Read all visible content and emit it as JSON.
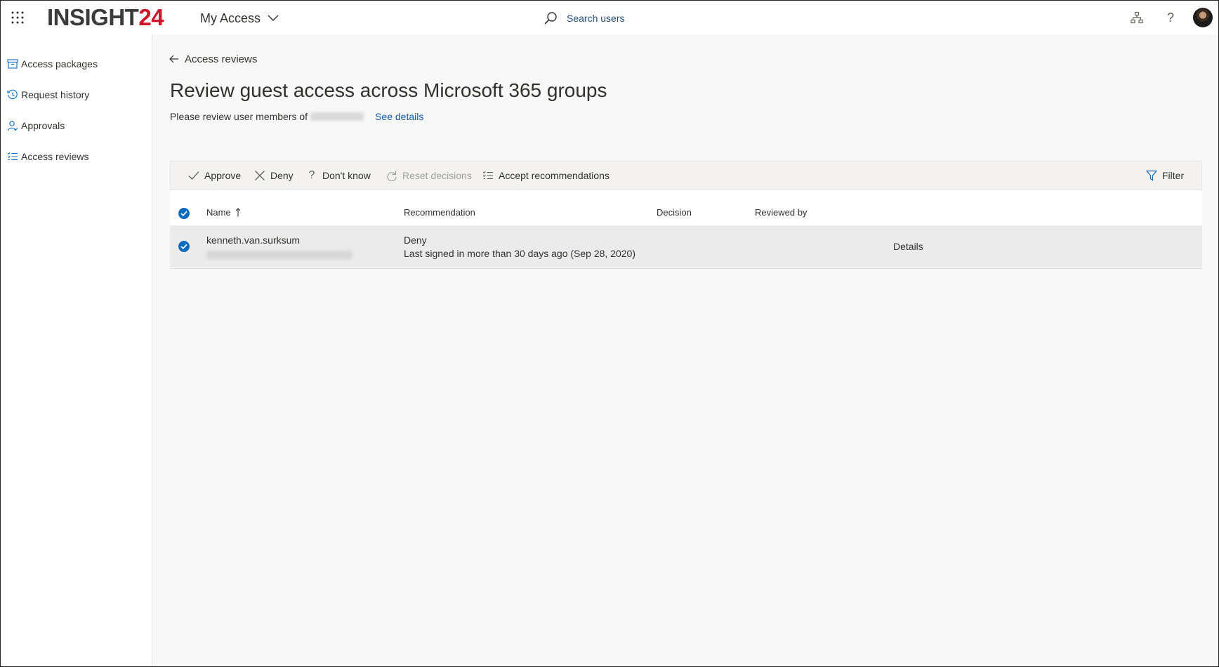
{
  "header": {
    "logo_text": "INSIGHT",
    "logo_number": "24",
    "app_name": "My Access",
    "search_label": "Search users",
    "help_symbol": "?"
  },
  "sidebar": {
    "items": [
      {
        "label": "Access packages",
        "icon": "package-icon"
      },
      {
        "label": "Request history",
        "icon": "history-icon"
      },
      {
        "label": "Approvals",
        "icon": "person-check-icon"
      },
      {
        "label": "Access reviews",
        "icon": "list-check-icon"
      }
    ]
  },
  "main": {
    "back_label": "Access reviews",
    "title": "Review guest access across Microsoft 365 groups",
    "subtitle_prefix": "Please review user members of",
    "see_details": "See details"
  },
  "toolbar": {
    "approve": "Approve",
    "deny": "Deny",
    "dont_know": "Don't know",
    "reset": "Reset decisions",
    "accept": "Accept recommendations",
    "filter": "Filter"
  },
  "table": {
    "columns": {
      "name": "Name",
      "recommendation": "Recommendation",
      "decision": "Decision",
      "reviewed_by": "Reviewed by"
    },
    "rows": [
      {
        "name": "kenneth.van.surksum",
        "recommendation": "Deny",
        "recommendation_detail": "Last signed in more than 30 days ago (Sep 28, 2020)",
        "decision": "",
        "reviewed_by": "",
        "details_link": "Details",
        "selected": true
      }
    ]
  },
  "colors": {
    "accent": "#0f6cbd",
    "link": "#0f5aa7",
    "logo_number": "#d0142c"
  }
}
